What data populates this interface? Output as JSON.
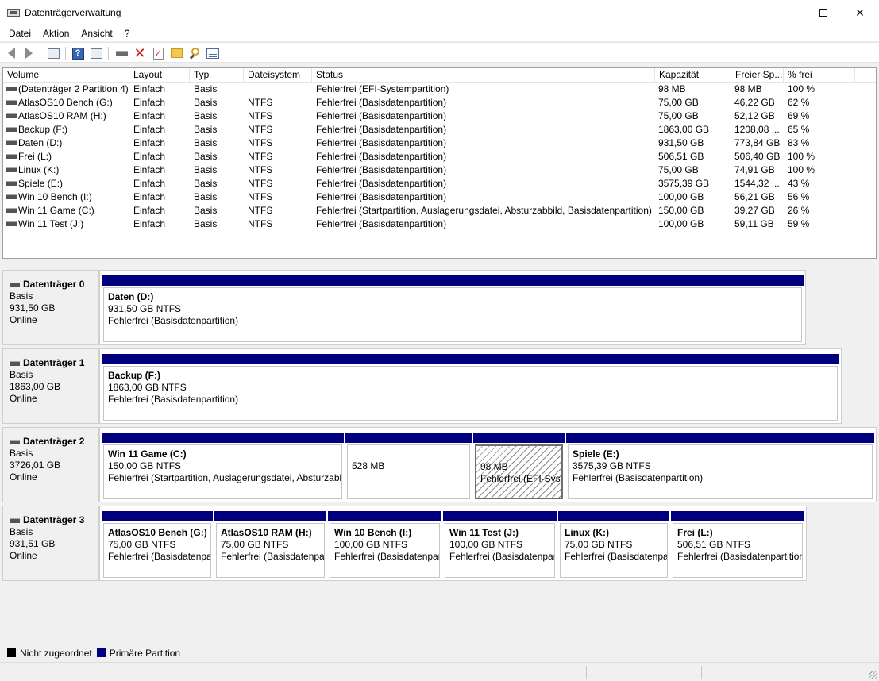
{
  "window": {
    "title": "Datenträgerverwaltung"
  },
  "menu": [
    "Datei",
    "Aktion",
    "Ansicht",
    "?"
  ],
  "toolbar": [
    "back-icon",
    "forward-icon",
    "disk-list-icon",
    "help-icon",
    "properties-icon",
    "connect-drive-icon",
    "delete-icon",
    "check-icon",
    "folder-up-icon",
    "search-icon",
    "window-icon"
  ],
  "columns": [
    "Volume",
    "Layout",
    "Typ",
    "Dateisystem",
    "Status",
    "Kapazität",
    "Freier Sp...",
    "% frei"
  ],
  "volumes": [
    {
      "volume": "(Datenträger 2 Partition 4)",
      "layout": "Einfach",
      "typ": "Basis",
      "fs": "",
      "status": "Fehlerfrei (EFI-Systempartition)",
      "cap": "98 MB",
      "free": "98 MB",
      "pct": "100 %"
    },
    {
      "volume": "AtlasOS10 Bench (G:)",
      "layout": "Einfach",
      "typ": "Basis",
      "fs": "NTFS",
      "status": "Fehlerfrei (Basisdatenpartition)",
      "cap": "75,00 GB",
      "free": "46,22 GB",
      "pct": "62 %"
    },
    {
      "volume": "AtlasOS10 RAM (H:)",
      "layout": "Einfach",
      "typ": "Basis",
      "fs": "NTFS",
      "status": "Fehlerfrei (Basisdatenpartition)",
      "cap": "75,00 GB",
      "free": "52,12 GB",
      "pct": "69 %"
    },
    {
      "volume": "Backup (F:)",
      "layout": "Einfach",
      "typ": "Basis",
      "fs": "NTFS",
      "status": "Fehlerfrei (Basisdatenpartition)",
      "cap": "1863,00 GB",
      "free": "1208,08 ...",
      "pct": "65 %"
    },
    {
      "volume": "Daten (D:)",
      "layout": "Einfach",
      "typ": "Basis",
      "fs": "NTFS",
      "status": "Fehlerfrei (Basisdatenpartition)",
      "cap": "931,50 GB",
      "free": "773,84 GB",
      "pct": "83 %"
    },
    {
      "volume": "Frei (L:)",
      "layout": "Einfach",
      "typ": "Basis",
      "fs": "NTFS",
      "status": "Fehlerfrei (Basisdatenpartition)",
      "cap": "506,51 GB",
      "free": "506,40 GB",
      "pct": "100 %"
    },
    {
      "volume": "Linux (K:)",
      "layout": "Einfach",
      "typ": "Basis",
      "fs": "NTFS",
      "status": "Fehlerfrei (Basisdatenpartition)",
      "cap": "75,00 GB",
      "free": "74,91 GB",
      "pct": "100 %"
    },
    {
      "volume": "Spiele (E:)",
      "layout": "Einfach",
      "typ": "Basis",
      "fs": "NTFS",
      "status": "Fehlerfrei (Basisdatenpartition)",
      "cap": "3575,39 GB",
      "free": "1544,32 ...",
      "pct": "43 %"
    },
    {
      "volume": "Win 10 Bench (I:)",
      "layout": "Einfach",
      "typ": "Basis",
      "fs": "NTFS",
      "status": "Fehlerfrei (Basisdatenpartition)",
      "cap": "100,00 GB",
      "free": "56,21 GB",
      "pct": "56 %"
    },
    {
      "volume": "Win 11 Game (C:)",
      "layout": "Einfach",
      "typ": "Basis",
      "fs": "NTFS",
      "status": "Fehlerfrei (Startpartition, Auslagerungsdatei, Absturzabbild, Basisdatenpartition)",
      "cap": "150,00 GB",
      "free": "39,27 GB",
      "pct": "26 %"
    },
    {
      "volume": "Win 11 Test (J:)",
      "layout": "Einfach",
      "typ": "Basis",
      "fs": "NTFS",
      "status": "Fehlerfrei (Basisdatenpartition)",
      "cap": "100,00 GB",
      "free": "59,11 GB",
      "pct": "59 %"
    }
  ],
  "disks": [
    {
      "name": "Datenträger 0",
      "type": "Basis",
      "size": "931,50 GB",
      "state": "Online",
      "partitions": [
        {
          "name": "Daten  (D:)",
          "size": "931,50 GB NTFS",
          "status": "Fehlerfrei (Basisdatenpartition)"
        }
      ]
    },
    {
      "name": "Datenträger 1",
      "type": "Basis",
      "size": "1863,00 GB",
      "state": "Online",
      "partitions": [
        {
          "name": "Backup  (F:)",
          "size": "1863,00 GB NTFS",
          "status": "Fehlerfrei (Basisdatenpartition)"
        }
      ]
    },
    {
      "name": "Datenträger 2",
      "type": "Basis",
      "size": "3726,01 GB",
      "state": "Online",
      "partitions": [
        {
          "name": "Win 11 Game  (C:)",
          "size": "150,00 GB NTFS",
          "status": "Fehlerfrei (Startpartition, Auslagerungsdatei, Absturzabbild"
        },
        {
          "name": "",
          "size": "528 MB",
          "status": ""
        },
        {
          "name": "",
          "size": "98 MB",
          "status": "Fehlerfrei (EFI-Systempartition)"
        },
        {
          "name": "Spiele  (E:)",
          "size": "3575,39 GB NTFS",
          "status": "Fehlerfrei (Basisdatenpartition)"
        }
      ]
    },
    {
      "name": "Datenträger 3",
      "type": "Basis",
      "size": "931,51 GB",
      "state": "Online",
      "partitions": [
        {
          "name": "AtlasOS10 Bench  (G:)",
          "size": "75,00 GB NTFS",
          "status": "Fehlerfrei (Basisdatenpartition)"
        },
        {
          "name": "AtlasOS10 RAM  (H:)",
          "size": "75,00 GB NTFS",
          "status": "Fehlerfrei (Basisdatenpartition)"
        },
        {
          "name": "Win 10 Bench  (I:)",
          "size": "100,00 GB NTFS",
          "status": "Fehlerfrei (Basisdatenpartition)"
        },
        {
          "name": "Win 11 Test  (J:)",
          "size": "100,00 GB NTFS",
          "status": "Fehlerfrei (Basisdatenpartition)"
        },
        {
          "name": "Linux  (K:)",
          "size": "75,00 GB NTFS",
          "status": "Fehlerfrei (Basisdatenpartition)"
        },
        {
          "name": "Frei  (L:)",
          "size": "506,51 GB NTFS",
          "status": "Fehlerfrei (Basisdatenpartition)"
        }
      ]
    }
  ],
  "legend": {
    "unallocated": "Nicht zugeordnet",
    "primary": "Primäre Partition",
    "unallocated_color": "#000000",
    "primary_color": "#00007f"
  }
}
